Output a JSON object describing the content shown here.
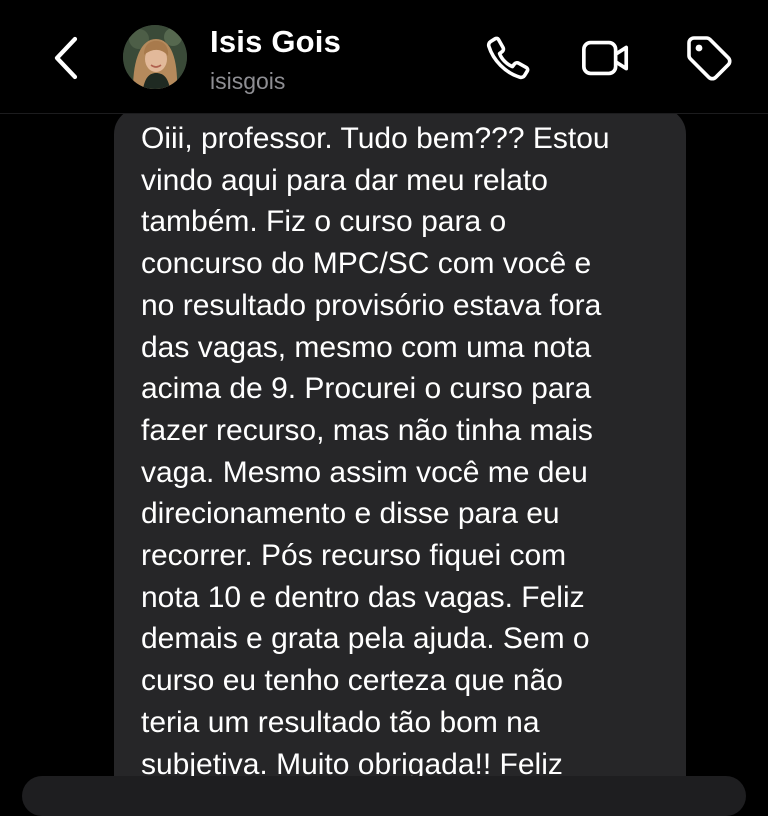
{
  "header": {
    "back_icon": "chevron-left-icon",
    "contact": {
      "name": "Isis Gois",
      "handle": "isisgois"
    },
    "actions": [
      {
        "icon": "phone-icon"
      },
      {
        "icon": "video-camera-icon"
      },
      {
        "icon": "tag-icon"
      }
    ]
  },
  "colors": {
    "background": "#000000",
    "bubble": "#262628",
    "text": "#ffffff",
    "secondary_text": "#8e8e93"
  },
  "messages": [
    {
      "direction": "incoming",
      "lines": [
        "Oiii, professor. Tudo bem??? Estou",
        "vindo aqui para dar meu relato",
        "também. Fiz o curso para o",
        "concurso do MPC/SC com você e",
        "no resultado provisório estava fora",
        "das vagas, mesmo com uma nota",
        "acima de 9. Procurei o curso para",
        "fazer recurso, mas não tinha mais",
        "vaga. Mesmo assim você me deu",
        "direcionamento e disse para eu",
        "recorrer. Pós recurso fiquei com",
        "nota 10 e dentro das vagas. Feliz",
        "demais e grata pela ajuda. Sem o",
        "curso eu tenho certeza que não",
        "teria um resultado tão bom na",
        "subjetiva. Muito obrigada!! Feliz"
      ]
    }
  ]
}
